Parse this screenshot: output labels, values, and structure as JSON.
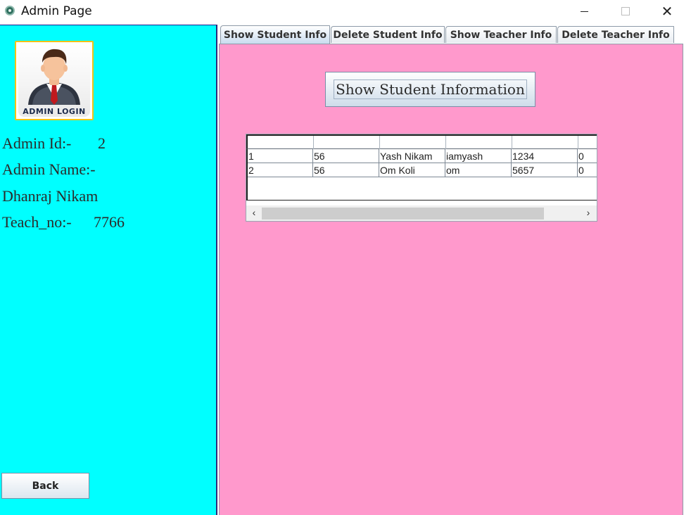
{
  "window": {
    "title": "Admin Page",
    "minimize_icon": "minimize-icon",
    "maximize_icon": "maximize-icon",
    "close_symbol": "✕"
  },
  "sidebar": {
    "logo_caption": "ADMIN LOGIN",
    "admin_id_label": "Admin Id:-",
    "admin_id_value": "2",
    "admin_name_label": "Admin Name:-",
    "admin_name_value": "Dhanraj Nikam",
    "teach_no_label": "Teach_no:-",
    "teach_no_value": "7766",
    "back_label": "Back",
    "background_color": "#00ffff"
  },
  "tabs": [
    {
      "label": "Show Student Info",
      "active": true
    },
    {
      "label": "Delete Student Info",
      "active": false
    },
    {
      "label": "Show Teacher Info",
      "active": false
    },
    {
      "label": "Delete Teacher Info",
      "active": false
    }
  ],
  "main": {
    "background_color": "#ff99cc",
    "show_button_label": "Show Student Information",
    "table": {
      "columns": [
        "",
        "",
        "",
        "",
        "",
        ""
      ],
      "rows": [
        [
          "1",
          "56",
          "Yash Nikam",
          "iamyash",
          "1234",
          "0"
        ],
        [
          "2",
          "56",
          "Om Koli",
          "om",
          "5657",
          "0"
        ]
      ]
    },
    "scrollbar": {
      "left_arrow": "‹",
      "right_arrow": "›"
    }
  }
}
